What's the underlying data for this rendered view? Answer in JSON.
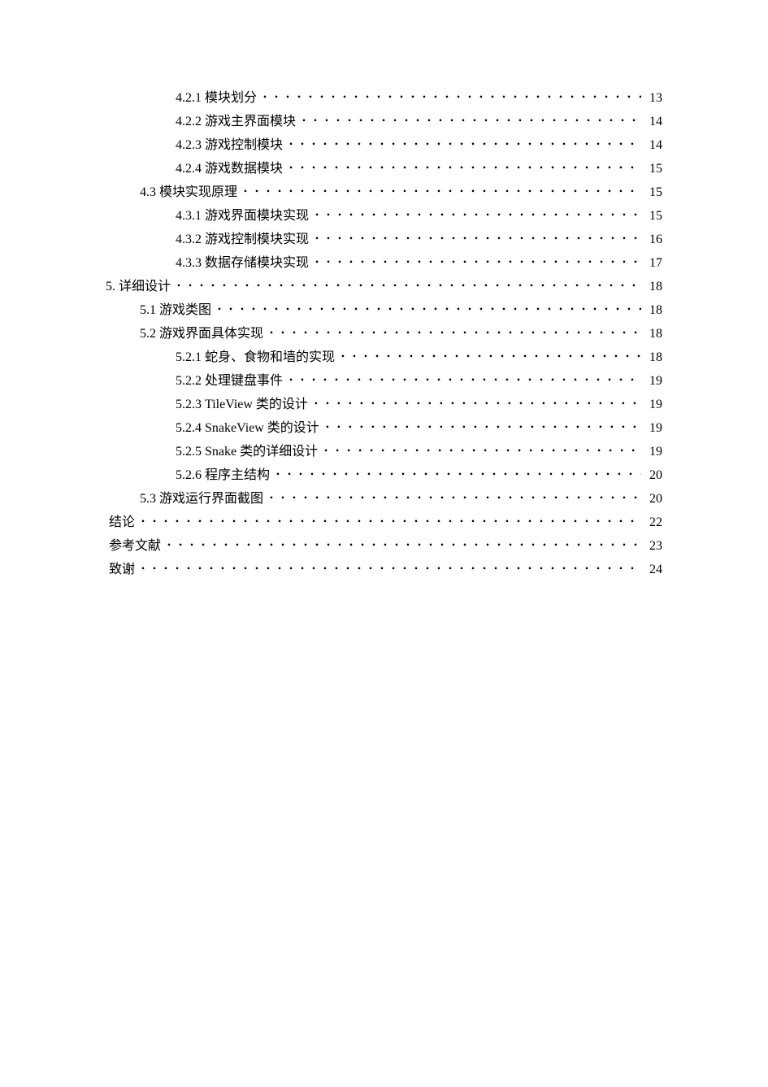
{
  "toc": [
    {
      "level": 3,
      "number": "4.2.1",
      "title": "模块划分",
      "page": "13"
    },
    {
      "level": 3,
      "number": "4.2.2",
      "title": "游戏主界面模块",
      "page": "14"
    },
    {
      "level": 3,
      "number": "4.2.3",
      "title": "游戏控制模块",
      "page": "14"
    },
    {
      "level": 3,
      "number": "4.2.4",
      "title": "游戏数据模块",
      "page": "15"
    },
    {
      "level": 2,
      "number": "4.3",
      "title": "模块实现原理",
      "page": "15"
    },
    {
      "level": 3,
      "number": "4.3.1",
      "title": "游戏界面模块实现",
      "page": "15"
    },
    {
      "level": 3,
      "number": "4.3.2",
      "title": "游戏控制模块实现",
      "page": "16"
    },
    {
      "level": 3,
      "number": "4.3.3",
      "title": "数据存储模块实现",
      "page": "17"
    },
    {
      "level": 1,
      "number": "5.",
      "title": "详细设计",
      "page": "18"
    },
    {
      "level": 2,
      "number": "5.1",
      "title": "游戏类图",
      "page": "18"
    },
    {
      "level": 2,
      "number": "5.2",
      "title": "游戏界面具体实现",
      "page": "18"
    },
    {
      "level": 3,
      "number": "5.2.1",
      "title": "蛇身、食物和墙的实现",
      "page": "18"
    },
    {
      "level": 3,
      "number": "5.2.2",
      "title": "处理键盘事件",
      "page": "19"
    },
    {
      "level": 3,
      "number": "5.2.3",
      "title": "TileView 类的设计",
      "page": "19"
    },
    {
      "level": 3,
      "number": "5.2.4",
      "title": "SnakeView 类的设计",
      "page": "19"
    },
    {
      "level": 3,
      "number": "5.2.5",
      "title": "Snake 类的详细设计",
      "page": "19"
    },
    {
      "level": 3,
      "number": "5.2.6",
      "title": "程序主结构",
      "page": "20"
    },
    {
      "level": 2,
      "number": "5.3",
      "title": "游戏运行界面截图",
      "page": "20"
    },
    {
      "level": 0,
      "number": "",
      "title": "结论",
      "page": "22"
    },
    {
      "level": 0,
      "number": "",
      "title": "参考文献",
      "page": "23"
    },
    {
      "level": 0,
      "number": "",
      "title": "致谢",
      "page": "24"
    }
  ],
  "dot_fill": "･････････････････････････････････････････････････････････････････････････････････････････････"
}
